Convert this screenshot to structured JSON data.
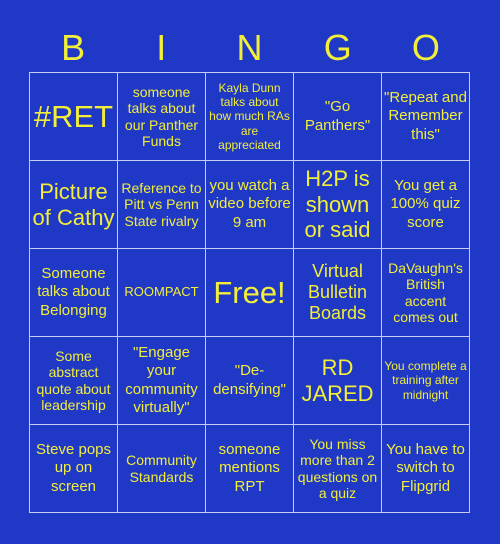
{
  "header": {
    "letters": [
      "B",
      "I",
      "N",
      "G",
      "O"
    ]
  },
  "board": {
    "cells": [
      "#RET",
      "someone talks about our Panther Funds",
      "Kayla Dunn talks about how much RAs are appreciated",
      "\"Go Panthers\"",
      "\"Repeat and Remember this\"",
      "Picture of Cathy",
      "Reference to Pitt vs Penn State rivalry",
      "you watch a video before 9 am",
      "H2P is shown or said",
      "You get a 100% quiz score",
      "Someone talks about Belonging",
      "ROOMPACT",
      "Free!",
      "Virtual Bulletin Boards",
      "DaVaughn's British accent comes out",
      "Some abstract quote about leadership",
      "\"Engage your community virtually\"",
      "\"De-densifying\"",
      "RD JARED",
      "You complete a training after midnight",
      "Steve pops up on screen",
      "Community Standards",
      "someone mentions RPT",
      "You miss more than 2 questions on a quiz",
      "You have to switch to Flipgrid"
    ]
  },
  "colors": {
    "background": "#1f38c6",
    "text": "#f2ee3a",
    "grid_lines": "#c8ccf0"
  }
}
